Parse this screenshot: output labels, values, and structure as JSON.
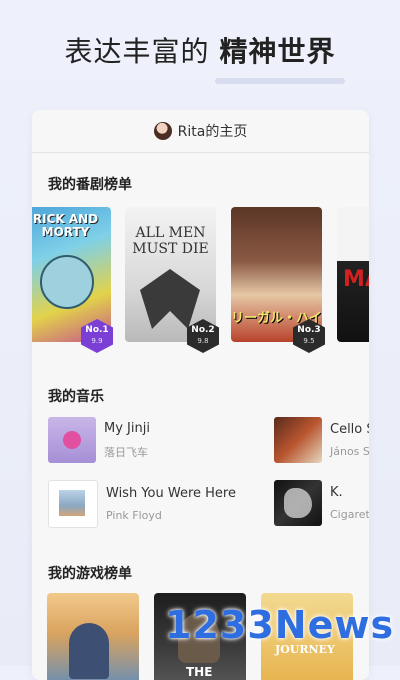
{
  "hero": {
    "title_normal": "表达丰富的 ",
    "title_bold": "精神世界"
  },
  "profile": {
    "name": "Rita的主页"
  },
  "sections": {
    "dramas": "我的番剧榜单",
    "music": "我的音乐",
    "games": "我的游戏榜单"
  },
  "dramas": [
    {
      "poster_text": "RICK AND MORTY",
      "rank": "No.1",
      "score": "9.9",
      "badge_color": "#7b3fd6"
    },
    {
      "poster_text": "ALL MEN MUST DIE",
      "rank": "No.2",
      "score": "9.8",
      "badge_color": "#2b2b2b"
    },
    {
      "poster_text": "リーガル・ハイ",
      "rank": "No.3",
      "score": "9.5",
      "badge_color": "#2b2b2b"
    },
    {
      "poster_text": "MA",
      "rank": "",
      "score": "",
      "badge_color": ""
    }
  ],
  "music": [
    {
      "title": "My Jinji",
      "artist": "落日飞车"
    },
    {
      "title": "Cello S",
      "artist": "János S"
    },
    {
      "title": "Wish You Were Here",
      "artist": "Pink Floyd"
    },
    {
      "title": "K.",
      "artist": "Cigaret"
    }
  ],
  "games": [
    {
      "poster_text": ""
    },
    {
      "poster_text": "THE"
    },
    {
      "poster_text": "JOURNEY"
    }
  ],
  "watermark": "1233News",
  "colors": {
    "background": "#eef1fb",
    "card": "#f7f7f8",
    "watermark": "#2f6ee0"
  }
}
